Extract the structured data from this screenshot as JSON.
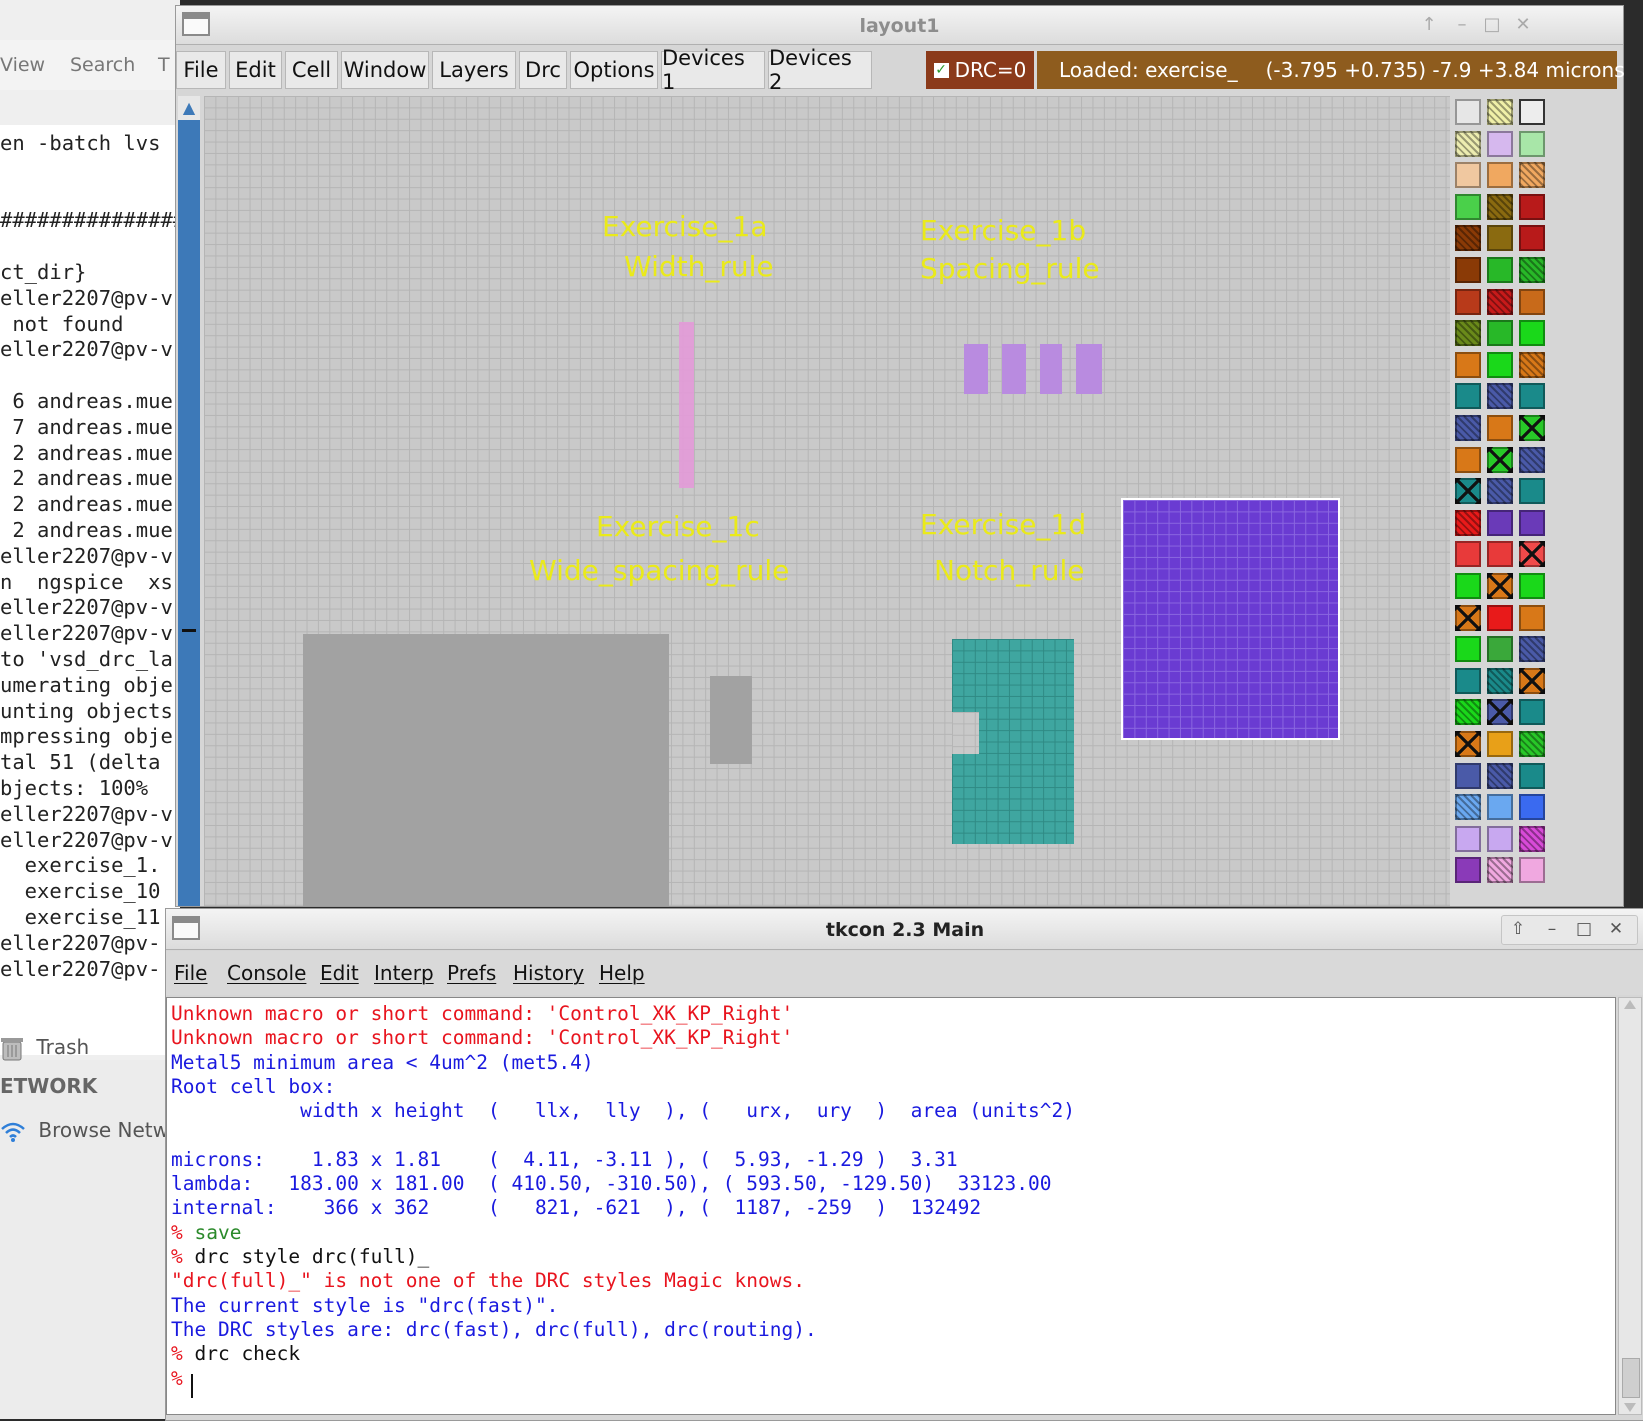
{
  "background": {
    "menu": [
      "View",
      "Search",
      "T"
    ],
    "terminal_lines": [
      "en -batch lvs",
      "",
      "",
      "###############",
      "",
      "ct_dir}",
      "eller2207@pv-v",
      " not found",
      "eller2207@pv-v",
      "",
      " 6 andreas.mue",
      " 7 andreas.mue",
      " 2 andreas.mue",
      " 2 andreas.mue",
      " 2 andreas.mue",
      " 2 andreas.mue",
      "eller2207@pv-v",
      "n  ngspice  xs",
      "eller2207@pv-v",
      "eller2207@pv-v",
      "to 'vsd_drc_la",
      "umerating obje",
      "unting objects",
      "mpressing obje",
      "tal 51 (delta",
      "bjects: 100%",
      "eller2207@pv-v",
      "eller2207@pv-v",
      "  exercise_1.",
      "  exercise_10",
      "  exercise_11",
      "eller2207@pv-",
      "eller2207@pv-"
    ],
    "sidebar": {
      "trash": "Trash",
      "network_header": "ETWORK",
      "browse_network": "Browse Netw"
    }
  },
  "layout_window": {
    "title": "layout1",
    "menu": [
      "File",
      "Edit",
      "Cell",
      "Window",
      "Layers",
      "Drc",
      "Options",
      "Devices 1",
      "Devices 2"
    ],
    "drc_status": "DRC=0",
    "loaded": "Loaded: exercise_",
    "coords": "(-3.795 +0.735) -7.9 +3.84 microns",
    "labels": [
      "Exercise_1a",
      "Width_rule",
      "Exercise_1b",
      "Spacing_rule",
      "Exercise_1c",
      "Wide_spacing_rule",
      "Exercise_1d",
      "Notch_rule"
    ]
  },
  "tkcon_window": {
    "title": "tkcon 2.3 Main",
    "menu": [
      "File",
      "Console",
      "Edit",
      "Interp",
      "Prefs",
      "History",
      "Help"
    ],
    "lines": [
      {
        "color": "red",
        "text": "Unknown macro or short command: 'Control_XK_KP_Right'"
      },
      {
        "color": "red",
        "text": "Unknown macro or short command: 'Control_XK_KP_Right'"
      },
      {
        "color": "blue",
        "text": "Metal5 minimum area < 4um^2 (met5.4)"
      },
      {
        "color": "blue",
        "text": "Root cell box:"
      },
      {
        "color": "blue",
        "text": "           width x height  (   llx,  lly  ), (   urx,  ury  )  area (units^2)"
      },
      {
        "color": "blue",
        "text": ""
      },
      {
        "color": "blue",
        "text": "microns:    1.83 x 1.81    (  4.11, -3.11 ), (  5.93, -1.29 )  3.31"
      },
      {
        "color": "blue",
        "text": "lambda:   183.00 x 181.00  ( 410.50, -310.50), ( 593.50, -129.50)  33123.00"
      },
      {
        "color": "blue",
        "text": "internal:    366 x 362     (   821, -621  ), (  1187, -259  )  132492"
      },
      {
        "color": "green",
        "prompt": "% ",
        "text": "save"
      },
      {
        "color": "black",
        "prompt": "% ",
        "text": "drc style drc(full)_"
      },
      {
        "color": "red",
        "text": "\"drc(full)_\" is not one of the DRC styles Magic knows."
      },
      {
        "color": "blue",
        "text": "The current style is \"drc(fast)\"."
      },
      {
        "color": "blue",
        "text": "The DRC styles are: drc(fast), drc(full), drc(routing)."
      },
      {
        "color": "black",
        "prompt": "% ",
        "text": "drc check"
      },
      {
        "color": "black",
        "prompt": "% ",
        "text": ""
      }
    ]
  }
}
